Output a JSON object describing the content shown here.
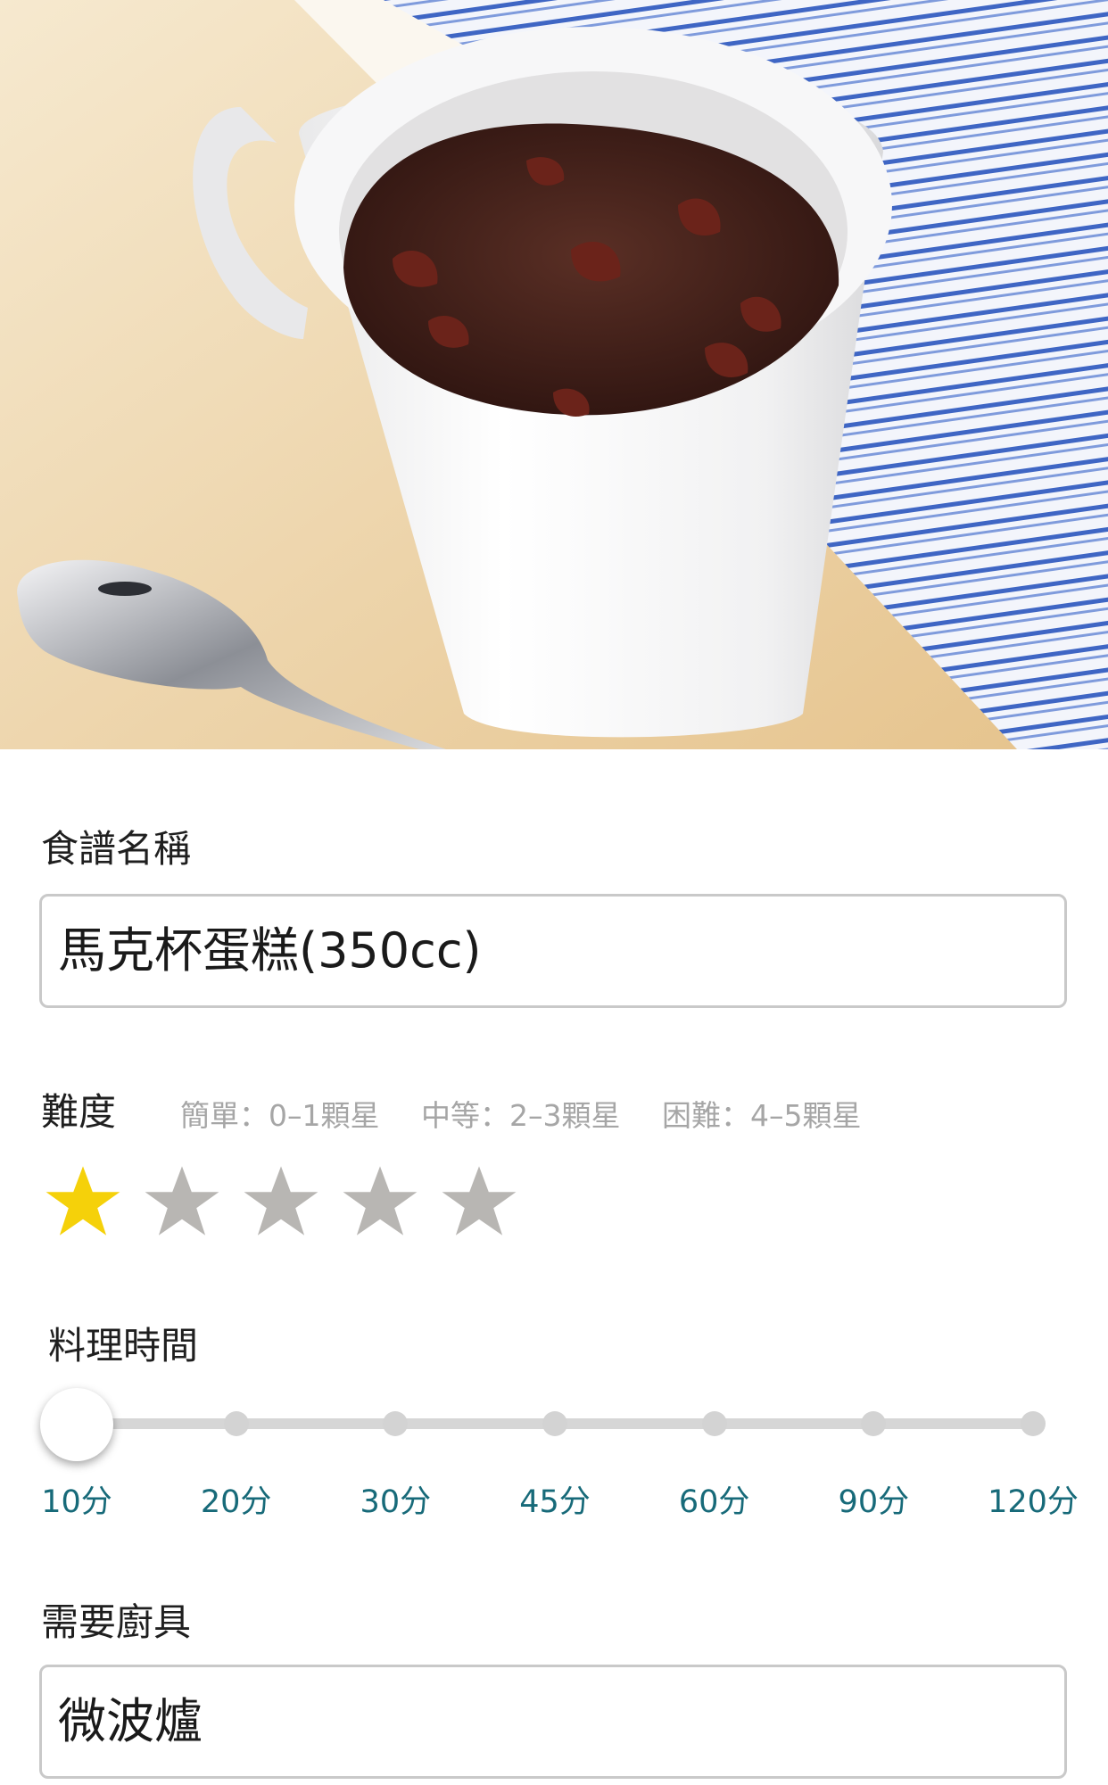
{
  "hero": {
    "image_name": "mug-cake-photo"
  },
  "recipe_name": {
    "label": "食譜名稱",
    "value": "馬克杯蛋糕(350cc)"
  },
  "difficulty": {
    "label": "難度",
    "hints": [
      "簡單：0–1顆星",
      "中等：2–3顆星",
      "困難：4–5顆星"
    ],
    "rating": 1,
    "max": 5,
    "active_color": "#f5d10a",
    "inactive_color": "#b8b6b3"
  },
  "cook_time": {
    "label": "料理時間",
    "options": [
      "10分",
      "20分",
      "30分",
      "45分",
      "60分",
      "90分",
      "120分"
    ],
    "selected_index": 0,
    "label_color": "#176a79"
  },
  "tools": {
    "label": "需要廚具",
    "value": "微波爐"
  }
}
